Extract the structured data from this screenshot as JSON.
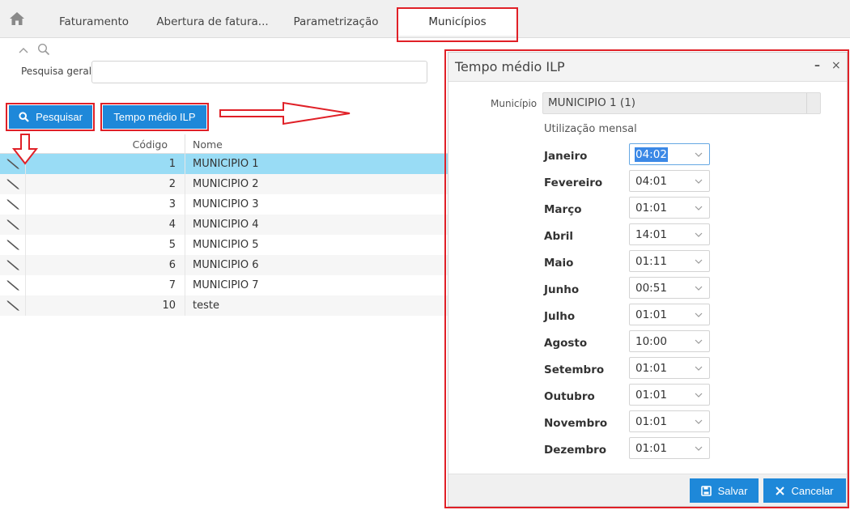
{
  "tabs": [
    {
      "label": "Faturamento"
    },
    {
      "label": "Abertura de fatura..."
    },
    {
      "label": "Parametrização"
    },
    {
      "label": "Municípios"
    }
  ],
  "search": {
    "label": "Pesquisa geral",
    "value": "",
    "placeholder": ""
  },
  "toolbar": {
    "pesquisar_label": "Pesquisar",
    "tempo_label": "Tempo médio ILP"
  },
  "grid": {
    "col_code": "Código",
    "col_name": "Nome",
    "rows": [
      {
        "code": "1",
        "name": "MUNICIPIO 1"
      },
      {
        "code": "2",
        "name": "MUNICIPIO 2"
      },
      {
        "code": "3",
        "name": "MUNICIPIO 3"
      },
      {
        "code": "4",
        "name": "MUNICIPIO 4"
      },
      {
        "code": "5",
        "name": "MUNICIPIO 5"
      },
      {
        "code": "6",
        "name": "MUNICIPIO 6"
      },
      {
        "code": "7",
        "name": "MUNICIPIO 7"
      },
      {
        "code": "10",
        "name": "teste"
      }
    ]
  },
  "modal": {
    "title": "Tempo médio ILP",
    "minimize": "–",
    "close": "×",
    "municipio_label": "Município",
    "municipio_value": "MUNICIPIO 1 (1)",
    "util_label": "Utilização mensal",
    "months": [
      {
        "name": "Janeiro",
        "value": "04:02"
      },
      {
        "name": "Fevereiro",
        "value": "04:01"
      },
      {
        "name": "Março",
        "value": "01:01"
      },
      {
        "name": "Abril",
        "value": "14:01"
      },
      {
        "name": "Maio",
        "value": "01:11"
      },
      {
        "name": "Junho",
        "value": "00:51"
      },
      {
        "name": "Julho",
        "value": "01:01"
      },
      {
        "name": "Agosto",
        "value": "10:00"
      },
      {
        "name": "Setembro",
        "value": "01:01"
      },
      {
        "name": "Outubro",
        "value": "01:01"
      },
      {
        "name": "Novembro",
        "value": "01:01"
      },
      {
        "name": "Dezembro",
        "value": "01:01"
      }
    ],
    "salvar_label": "Salvar",
    "cancelar_label": "Cancelar"
  },
  "colors": {
    "accent": "#1e88d9",
    "selected_row": "#99dcf5",
    "annotation": "#e02027"
  }
}
